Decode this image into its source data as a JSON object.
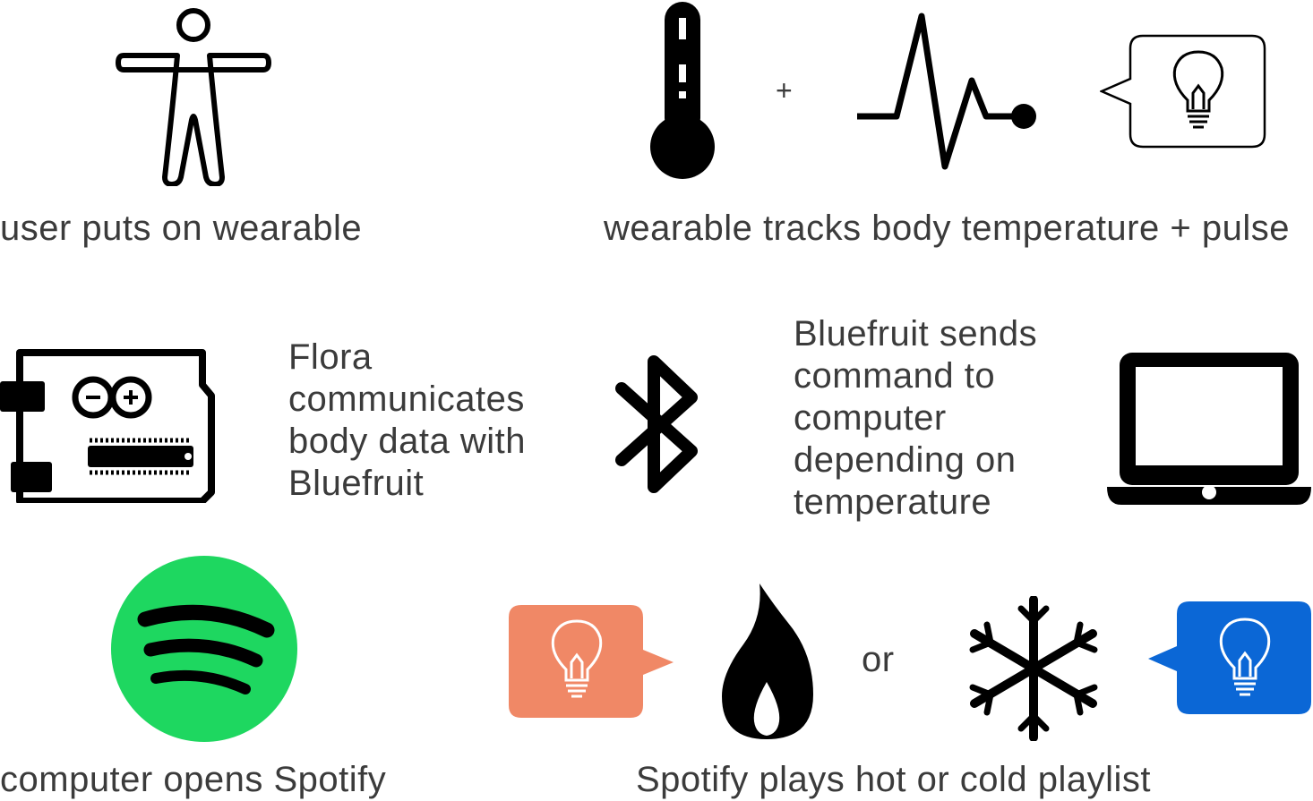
{
  "steps": {
    "wear": {
      "label": "user puts on wearable"
    },
    "track": {
      "label": "wearable tracks body temperature + pulse",
      "plus": "+"
    },
    "flora": {
      "lines": [
        "Flora",
        "communicates",
        "body data with",
        "Bluefruit"
      ]
    },
    "bluefruit": {
      "lines": [
        "Bluefruit sends",
        "command to",
        "computer",
        "depending on",
        "temperature"
      ]
    },
    "spotify": {
      "label": "computer opens Spotify"
    },
    "playlist": {
      "label": "Spotify plays hot or cold playlist",
      "or": "or"
    }
  },
  "icons": {
    "person": "person-icon",
    "thermometer": "thermometer-icon",
    "pulse": "pulse-icon",
    "idea_bubble": "lightbulb-bubble-icon",
    "board": "arduino-board-icon",
    "bluetooth": "bluetooth-icon",
    "laptop": "laptop-icon",
    "spotify": "spotify-logo-icon",
    "hot_bubble": "hot-lightbulb-bubble-icon",
    "flame": "flame-icon",
    "snowflake": "snowflake-icon",
    "cold_bubble": "cold-lightbulb-bubble-icon"
  },
  "colors": {
    "spotify_green": "#1ed760",
    "hot": "#f08866",
    "cold": "#0b67d6",
    "icon": "#000000"
  }
}
